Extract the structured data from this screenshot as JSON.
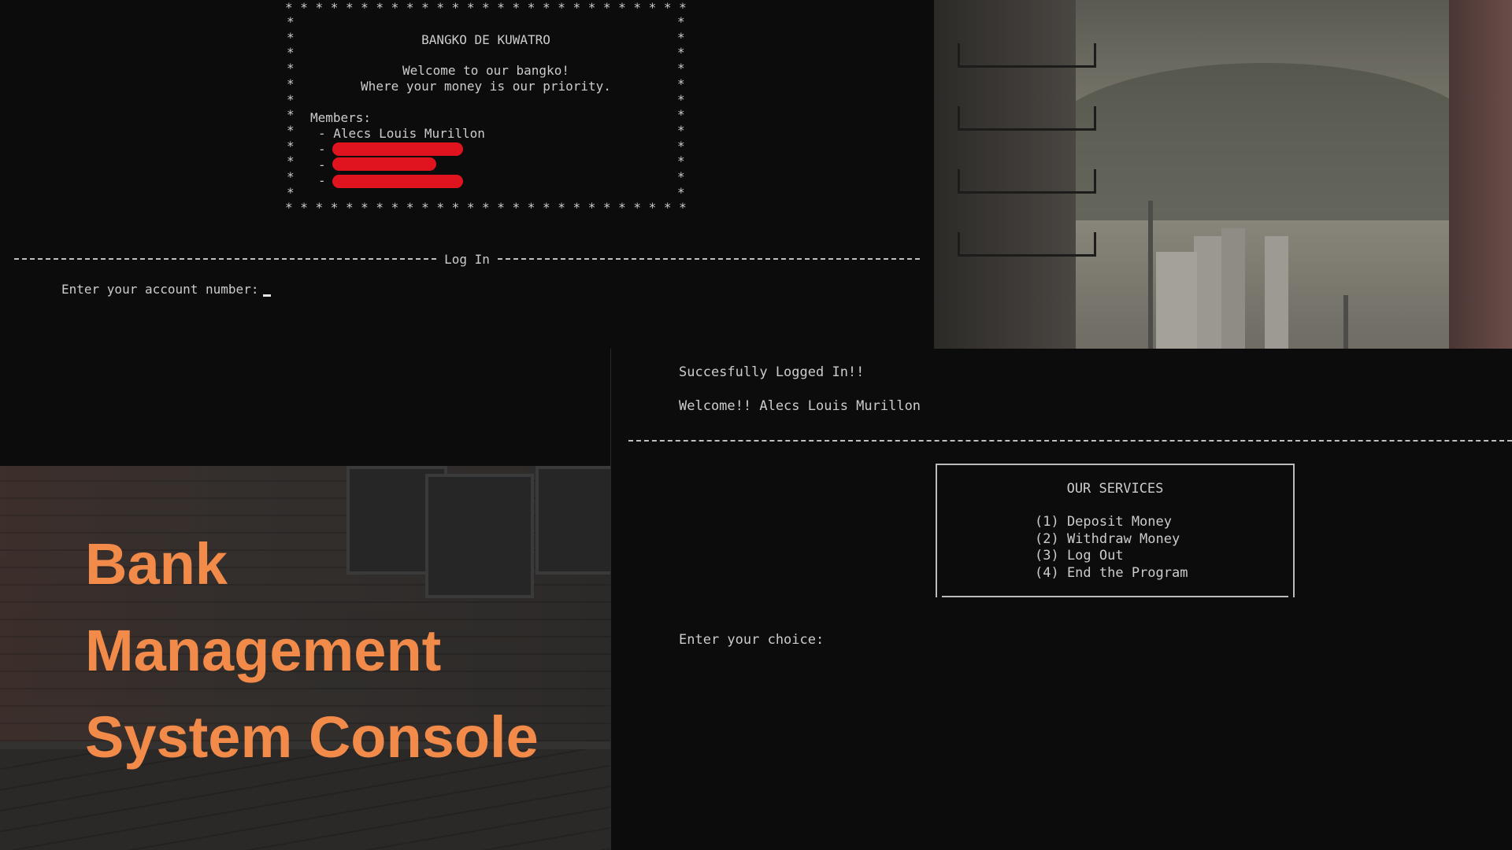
{
  "login_console": {
    "banner": {
      "title": "BANGKO DE KUWATRO",
      "welcome_line1": "Welcome to our bangko!",
      "welcome_line2": "Where your money is our priority.",
      "members_label": "Members:",
      "members": [
        "- Alecs Louis Murillon",
        "-",
        "-",
        "-"
      ]
    },
    "divider_label": "Log In",
    "account_prompt": "Enter your account number:",
    "redaction_color": "#e0141e"
  },
  "menu_console": {
    "login_message": "Succesfully Logged In!!",
    "welcome_message": "Welcome!! Alecs Louis Murillon",
    "services_title": "OUR SERVICES",
    "services": [
      "(1) Deposit Money",
      "(2) Withdraw Money",
      "(3) Log Out",
      "(4) End the Program"
    ],
    "choice_prompt": "Enter your choice:"
  },
  "branding": {
    "title_lines": [
      "Bank",
      "Management",
      "System Console"
    ],
    "accent_color": "#f28a49"
  },
  "console_colors": {
    "background": "#0c0c0c",
    "text": "#cccccc"
  }
}
